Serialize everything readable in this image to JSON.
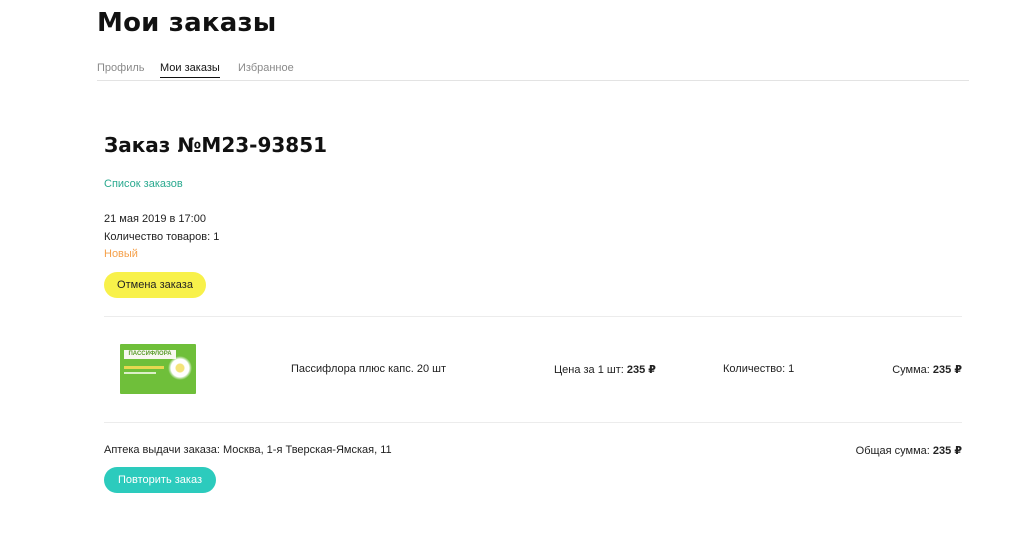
{
  "header": {
    "title": "Мои заказы"
  },
  "tabs": [
    {
      "label": "Профиль"
    },
    {
      "label": "Мои заказы",
      "active": true
    },
    {
      "label": "Избранное"
    }
  ],
  "order": {
    "title": "Заказ №M23-93851",
    "back_link": "Список заказов",
    "date": "21 мая 2019 в 17:00",
    "items_count": "Количество товаров: 1",
    "status": "Новый",
    "cancel_label": "Отмена заказа"
  },
  "product": {
    "image_icon": "product-package-image",
    "image_brand_text": "ПАССИФЛОРА",
    "name": "Пассифлора плюс капс. 20 шт",
    "price_label": "Цена за 1 шт:",
    "price_value": "235 ₽",
    "quantity": "Количество: 1",
    "sum_label": "Сумма:",
    "sum_value": "235 ₽"
  },
  "footer": {
    "pharmacy": "Аптека выдачи заказа: Москва, 1-я Тверская-Ямская, 11",
    "total_label": "Общая сумма:",
    "total_value": "235 ₽",
    "repeat_label": "Повторить заказ"
  },
  "colors": {
    "accent_link": "#2aa98f",
    "status_new": "#f5a04a",
    "cancel_button": "#f8f14a",
    "repeat_button": "#2ccbbd"
  }
}
